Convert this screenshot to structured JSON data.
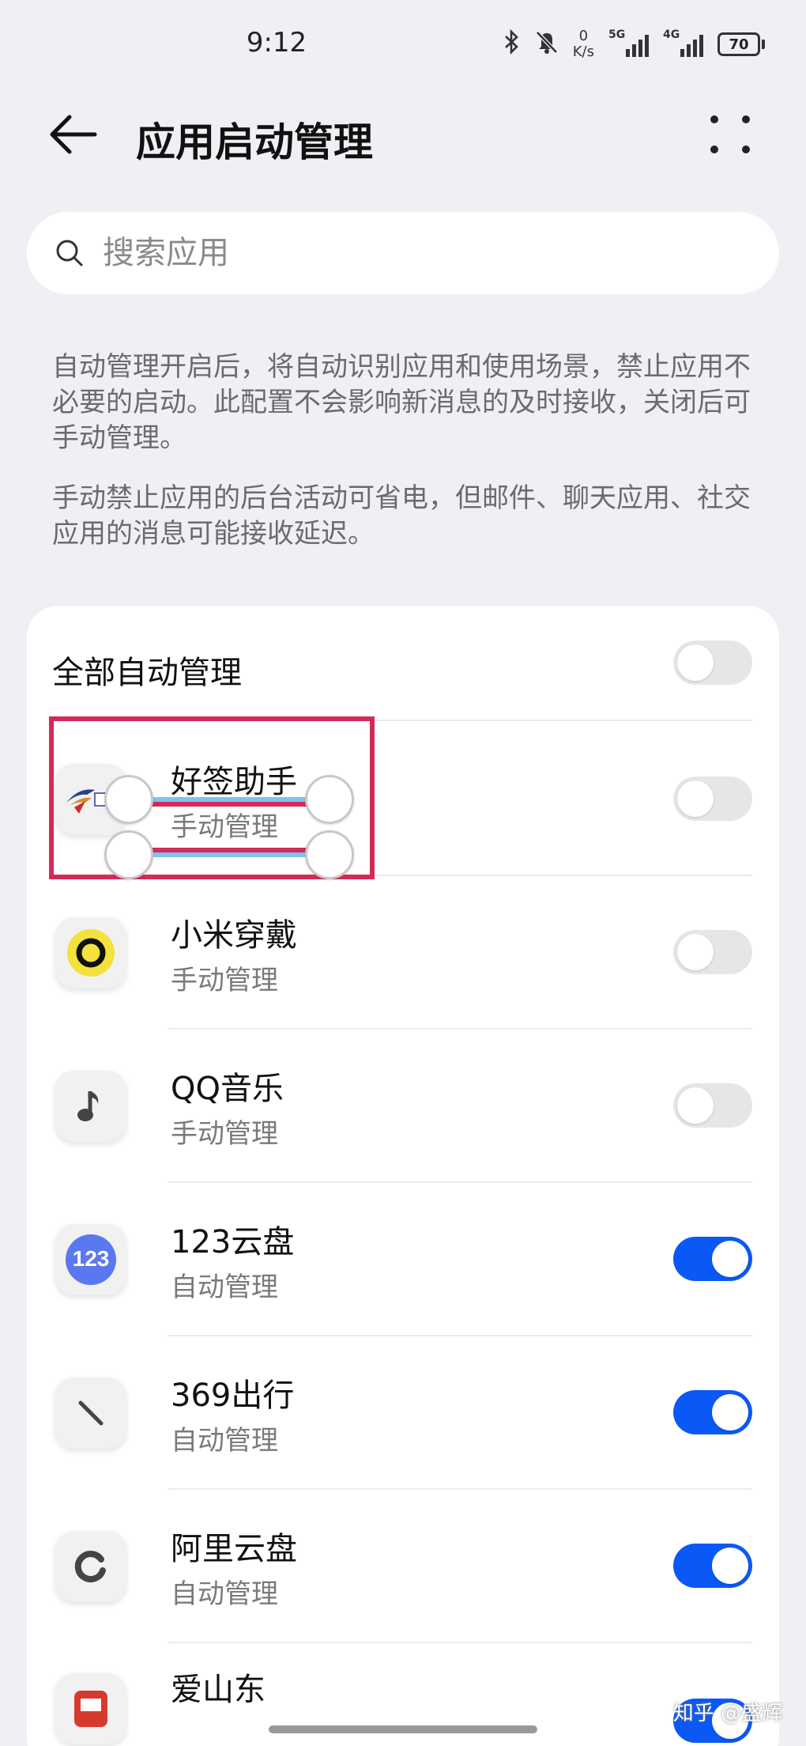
{
  "status_bar": {
    "time": "9:12",
    "net_speed_value": "0",
    "net_speed_unit": "K/s",
    "signal1_tag": "5G",
    "signal2_tag": "4G",
    "battery": "70",
    "icons": [
      "bluetooth-icon",
      "mute-bell-icon"
    ]
  },
  "header": {
    "title": "应用启动管理"
  },
  "search": {
    "placeholder": "搜索应用"
  },
  "description": {
    "para1": "自动管理开启后，将自动识别应用和使用场景，禁止应用不必要的启动。此配置不会影响新消息的及时接收，关闭后可手动管理。",
    "para2": "手动禁止应用的后台活动可省电，但邮件、聊天应用、社交应用的消息可能接收延迟。"
  },
  "all_row": {
    "label": "全部自动管理",
    "enabled": false
  },
  "apps": [
    {
      "name": "好签助手",
      "mode": "手动管理",
      "enabled": false,
      "icon": "haoqian-app-icon"
    },
    {
      "name": "小米穿戴",
      "mode": "手动管理",
      "enabled": false,
      "icon": "mi-wear-app-icon"
    },
    {
      "name": "QQ音乐",
      "mode": "手动管理",
      "enabled": false,
      "icon": "qq-music-app-icon"
    },
    {
      "name": "123云盘",
      "mode": "自动管理",
      "enabled": true,
      "icon": "123-cloud-app-icon",
      "icon_text": "123"
    },
    {
      "name": "369出行",
      "mode": "自动管理",
      "enabled": true,
      "icon": "369-travel-app-icon"
    },
    {
      "name": "阿里云盘",
      "mode": "自动管理",
      "enabled": true,
      "icon": "ali-cloud-app-icon"
    },
    {
      "name": "爱山东",
      "mode": "",
      "enabled": true,
      "icon": "ai-shandong-app-icon"
    }
  ],
  "watermark": "知乎 @盛辉",
  "colors": {
    "accent": "#0a59f7",
    "background": "#eef0f4",
    "selection_border": "#d42a5a",
    "selection_line": "#7cc4ec"
  }
}
